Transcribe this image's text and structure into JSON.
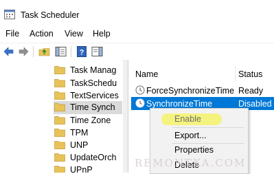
{
  "window": {
    "title": "Task Scheduler"
  },
  "menu": {
    "items": [
      "File",
      "Action",
      "View",
      "Help"
    ]
  },
  "toolbar": {
    "buttons": [
      "back-arrow-icon",
      "forward-arrow-icon",
      "up-folder-icon",
      "show-hide-console-tree-icon",
      "help-icon",
      "action-pane-icon"
    ]
  },
  "tree": {
    "items": [
      {
        "label": "Task Manag",
        "selected": false
      },
      {
        "label": "TaskSchedu",
        "selected": false
      },
      {
        "label": "TextServices",
        "selected": false
      },
      {
        "label": "Time Synch",
        "selected": true
      },
      {
        "label": "Time Zone",
        "selected": false
      },
      {
        "label": "TPM",
        "selected": false
      },
      {
        "label": "UNP",
        "selected": false
      },
      {
        "label": "UpdateOrch",
        "selected": false
      },
      {
        "label": "UPnP",
        "selected": false
      }
    ]
  },
  "task_list": {
    "columns": [
      "Name",
      "Status"
    ],
    "rows": [
      {
        "name": "ForceSynchronizeTime",
        "status": "Ready",
        "selected": false
      },
      {
        "name": "SynchronizeTime",
        "status": "Disabled",
        "selected": true
      }
    ]
  },
  "context_menu": {
    "items": [
      {
        "label": "Enable",
        "highlighted": true
      },
      {
        "label": "Export..."
      },
      {
        "label": "Properties"
      },
      {
        "label": "Delete"
      }
    ]
  },
  "watermark": {
    "text": "REMONTKA.COM"
  },
  "colors": {
    "selection": "#0078d7",
    "highlight_marker": "#f6f36b",
    "folder": "#e8c35a"
  }
}
